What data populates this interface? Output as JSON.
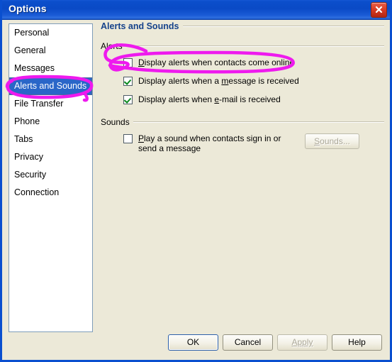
{
  "window": {
    "title": "Options",
    "close_icon": "close-icon",
    "titlebar_color": "#0A4AC6",
    "background_color": "#ECE9D8"
  },
  "sidebar": {
    "items": [
      {
        "label": "Personal",
        "selected": false
      },
      {
        "label": "General",
        "selected": false
      },
      {
        "label": "Messages",
        "selected": false
      },
      {
        "label": "Alerts and Sounds",
        "selected": true
      },
      {
        "label": "File Transfer",
        "selected": false
      },
      {
        "label": "Phone",
        "selected": false
      },
      {
        "label": "Tabs",
        "selected": false
      },
      {
        "label": "Privacy",
        "selected": false
      },
      {
        "label": "Security",
        "selected": false
      },
      {
        "label": "Connection",
        "selected": false
      }
    ],
    "selected_color": "#2A66C8"
  },
  "pane": {
    "heading": "Alerts and Sounds",
    "heading_color": "#15428B",
    "groups": {
      "alerts": {
        "label": "Alerts",
        "options": [
          {
            "checked": false,
            "text_before": "",
            "accel": "D",
            "text_after": "isplay alerts when contacts come online"
          },
          {
            "checked": true,
            "text_before": "Display alerts when a ",
            "accel": "m",
            "text_after": "essage is received"
          },
          {
            "checked": true,
            "text_before": "Display alerts when ",
            "accel": "e",
            "text_after": "-mail is received"
          }
        ]
      },
      "sounds": {
        "label": "Sounds",
        "option": {
          "checked": false,
          "text_before": "",
          "accel": "P",
          "text_after": "lay a sound when contacts sign in or send a message"
        },
        "button": {
          "label_before": "",
          "accel": "S",
          "label_after": "ounds...",
          "enabled": false
        }
      }
    }
  },
  "footer": {
    "buttons": [
      {
        "label": "OK",
        "enabled": true,
        "default": true
      },
      {
        "label": "Cancel",
        "enabled": true,
        "default": false
      },
      {
        "label": "Apply",
        "enabled": false,
        "default": false
      },
      {
        "label": "Help",
        "enabled": true,
        "default": false
      }
    ]
  },
  "annotations": {
    "color": "#EE1AEE",
    "shapes": [
      {
        "name": "sidebar-selection-circle",
        "target": "Alerts and Sounds"
      },
      {
        "name": "alerts-option-circle",
        "target": "Display alerts when contacts come online"
      }
    ]
  }
}
